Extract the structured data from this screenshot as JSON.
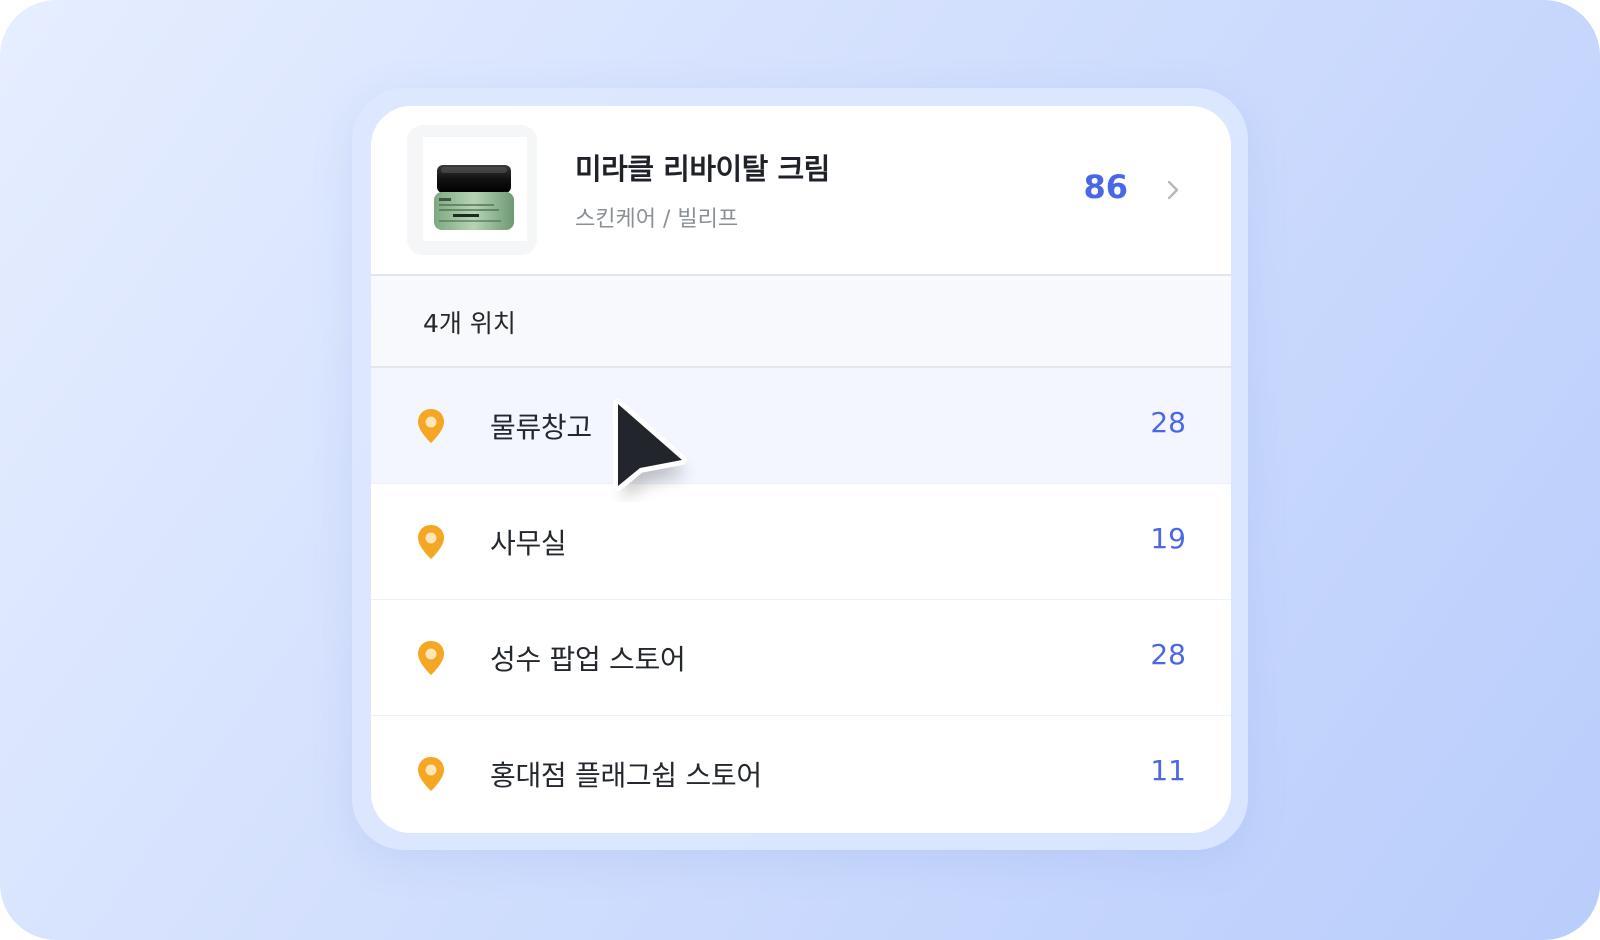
{
  "product": {
    "name": "미라클 리바이탈 크림",
    "category": "스킨케어 / 빌리프",
    "total": "86",
    "thumbnail_icon": "cream-jar-icon"
  },
  "locations_section": {
    "label": "4개 위치"
  },
  "locations": [
    {
      "name": "물류창고",
      "count": "28",
      "hovered": true
    },
    {
      "name": "사무실",
      "count": "19",
      "hovered": false
    },
    {
      "name": "성수 팝업 스토어",
      "count": "28",
      "hovered": false
    },
    {
      "name": "홍대점 플래그쉽 스토어",
      "count": "11",
      "hovered": false
    }
  ],
  "colors": {
    "accent": "#4a68e6",
    "pin": "#f5a623",
    "hover_row": "#f3f6fe"
  },
  "icons": {
    "location": "map-pin-icon",
    "chevron": "chevron-right-icon",
    "cursor": "mouse-pointer-icon"
  }
}
